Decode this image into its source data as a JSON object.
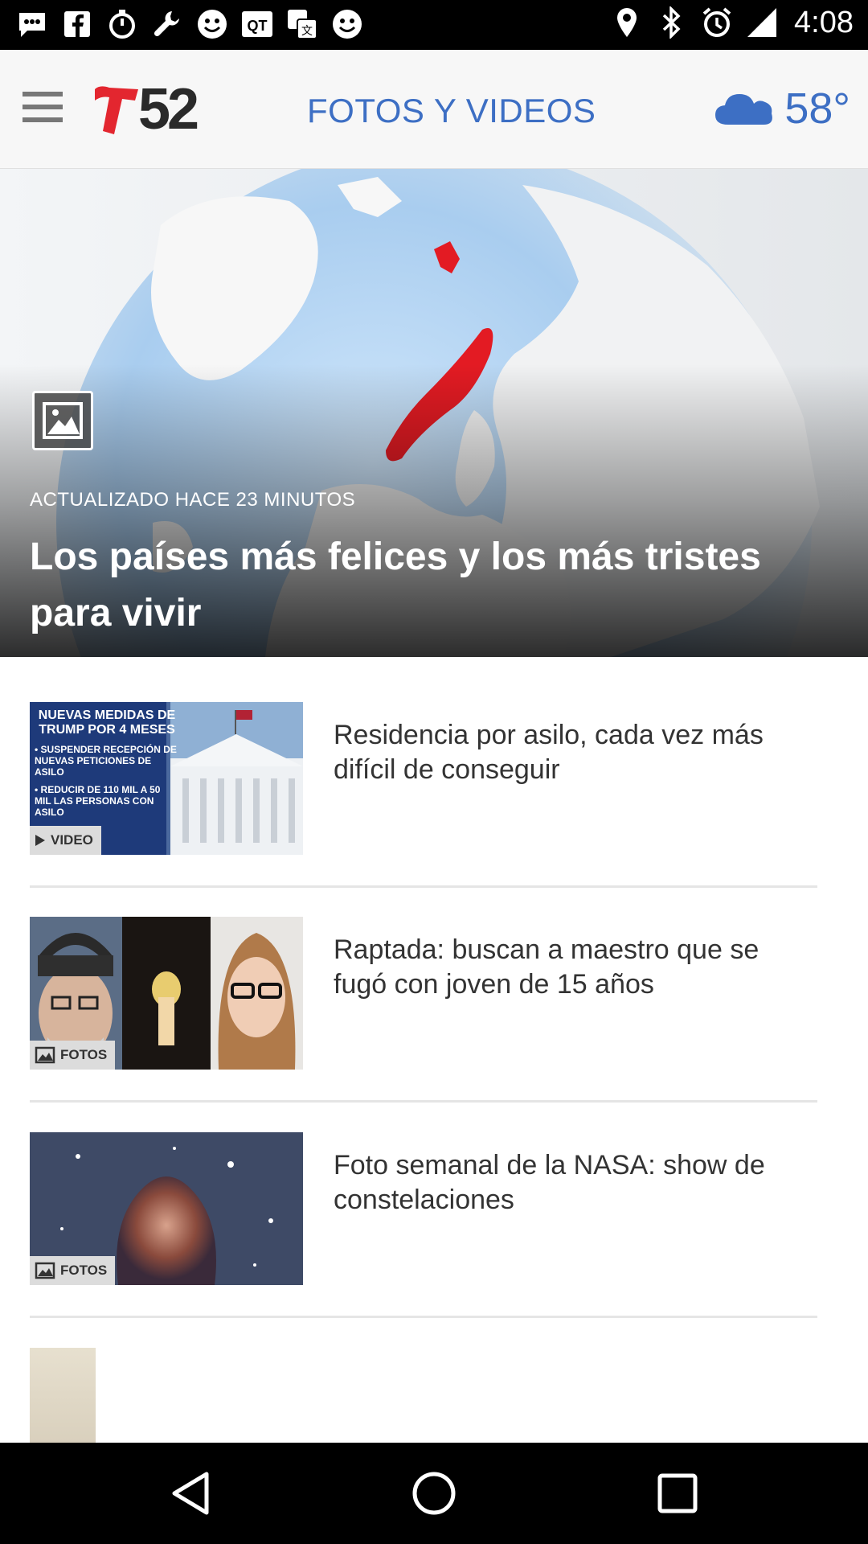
{
  "status_bar": {
    "time": "4:08",
    "left_icons": [
      "chat-icon",
      "facebook-icon",
      "stopwatch-icon",
      "wrench-icon",
      "smiley-icon",
      "qt-icon",
      "translate-icon",
      "smiley-icon",
      "location-icon",
      "bluetooth-icon",
      "alarm-icon",
      "signal-icon"
    ]
  },
  "app_bar": {
    "logo_number": "52",
    "title": "FOTOS Y VIDEOS",
    "temperature": "58°",
    "weather_icon": "cloud-icon"
  },
  "hero": {
    "updated": "ACTUALIZADO HACE 23 MINUTOS",
    "title": "Los países más felices y los más tristes para vivir",
    "icon": "gallery-icon"
  },
  "articles": [
    {
      "headline": "Residencia por asilo, cada vez más difícil de conseguir",
      "badge": "VIDEO",
      "thumb_heading": "NUEVAS MEDIDAS DE TRUMP POR 4 MESES",
      "thumb_bullets": [
        "• SUSPENDER RECEPCIÓN DE NUEVAS PETICIONES DE ASILO",
        "• REDUCIR DE 110 MIL A 50 MIL LAS PERSONAS CON ASILO"
      ]
    },
    {
      "headline": "Raptada: buscan a maestro que se fugó con joven de 15 años",
      "badge": "FOTOS"
    },
    {
      "headline": "Foto semanal de la NASA: show de constelaciones",
      "badge": "FOTOS"
    }
  ],
  "colors": {
    "accent": "#3d6fc4",
    "logo_red": "#e3262f",
    "status_bar": "#000000"
  }
}
